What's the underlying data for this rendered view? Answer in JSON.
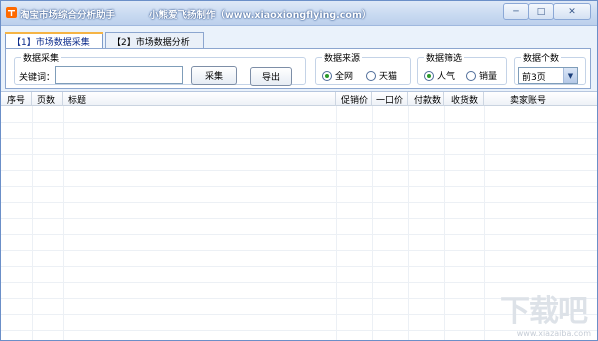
{
  "window": {
    "title": "淘宝市场综合分析助手",
    "credit": "小熊爱飞扬制作（www.xiaoxiongflying.com）"
  },
  "tabs": [
    {
      "label": "【1】市场数据采集",
      "active": true
    },
    {
      "label": "【2】市场数据分析",
      "active": false
    }
  ],
  "collect": {
    "legend": "数据采集",
    "keyword_label": "关键词：",
    "keyword_value": "",
    "collect_button": "采集",
    "export_button": "导出"
  },
  "source": {
    "legend": "数据来源",
    "options": [
      {
        "label": "全网",
        "selected": true
      },
      {
        "label": "天猫",
        "selected": false
      }
    ]
  },
  "filter": {
    "legend": "数据筛选",
    "options": [
      {
        "label": "人气",
        "selected": true
      },
      {
        "label": "销量",
        "selected": false
      }
    ]
  },
  "count": {
    "legend": "数据个数",
    "selected": "前3页"
  },
  "table": {
    "columns": [
      "序号",
      "页数",
      "标题",
      "促销价",
      "一口价",
      "付款数",
      "收货数",
      "卖家账号"
    ]
  },
  "watermark": {
    "logo": "下载吧",
    "url": "www.xiazaiba.com"
  },
  "icons": {
    "app": "taobao-icon",
    "minimize": "minimize-icon",
    "maximize": "maximize-icon",
    "close": "close-icon",
    "dropdown": "chevron-down-icon"
  },
  "colors": {
    "titlebar": "#c9daf1",
    "accent": "#f5b445",
    "radio_selected": "#2a9a2a"
  }
}
